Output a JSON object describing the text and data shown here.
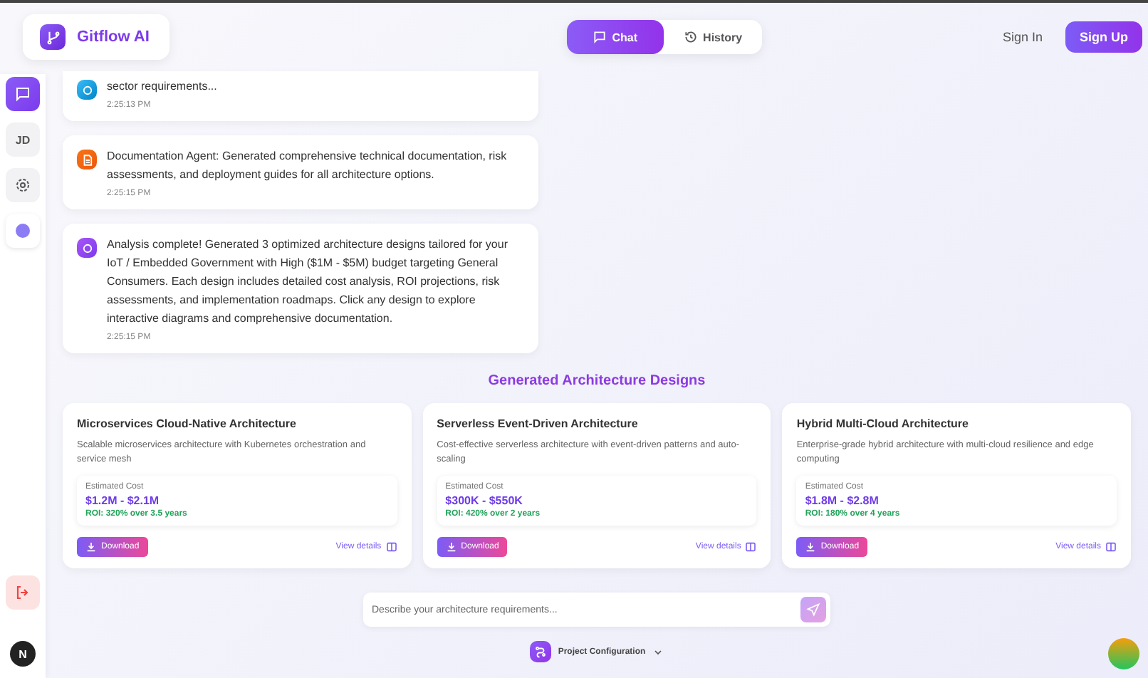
{
  "brand": {
    "name": "Gitflow AI"
  },
  "tabs": [
    {
      "label": "Chat",
      "selected": true,
      "kind": "chat"
    },
    {
      "label": "History",
      "selected": false,
      "kind": "history"
    }
  ],
  "auth": {
    "sign_in": "Sign In",
    "sign_up": "Sign Up"
  },
  "sidebar": {
    "items": [
      {
        "kind": "chat",
        "selected": true
      },
      {
        "kind": "avatar",
        "label": "JD",
        "selected": false
      },
      {
        "kind": "settings",
        "selected": false
      },
      {
        "kind": "dot",
        "selected": false
      }
    ],
    "user_initial": "N"
  },
  "messages": [
    {
      "kind": "info",
      "text": "sector requirements...",
      "time": "2:25:13 PM"
    },
    {
      "kind": "document",
      "text": "Documentation Agent: Generated comprehensive technical documentation, risk assessments, and deployment guides for all architecture options.",
      "time": "2:25:15 PM"
    },
    {
      "kind": "analysis",
      "text": "Analysis complete! Generated 3 optimized architecture designs tailored for your IoT / Embedded Government with High ($1M - $5M) budget targeting General Consumers. Each design includes detailed cost analysis, ROI projections, risk assessments, and implementation roadmaps. Click any design to explore interactive diagrams and comprehensive documentation.",
      "time": "2:25:15 PM"
    }
  ],
  "designs_title": "Generated Architecture Designs",
  "designs": [
    {
      "title": "Microservices Cloud-Native Architecture",
      "description": "Scalable microservices architecture with Kubernetes orchestration and service mesh",
      "cost_label": "Estimated Cost",
      "cost": "$1.2M - $2.1M",
      "roi": "ROI: 320% over 3.5 years",
      "download": "Download",
      "details": "View details"
    },
    {
      "title": "Serverless Event-Driven Architecture",
      "description": "Cost-effective serverless architecture with event-driven patterns and auto-scaling",
      "cost_label": "Estimated Cost",
      "cost": "$300K - $550K",
      "roi": "ROI: 420% over 2 years",
      "download": "Download",
      "details": "View details"
    },
    {
      "title": "Hybrid Multi-Cloud Architecture",
      "description": "Enterprise-grade hybrid architecture with multi-cloud resilience and edge computing",
      "cost_label": "Estimated Cost",
      "cost": "$1.8M - $2.8M",
      "roi": "ROI: 180% over 4 years",
      "download": "Download",
      "details": "View details"
    }
  ],
  "composer": {
    "placeholder": "Describe your architecture requirements..."
  },
  "project_config": {
    "label": "Project Configuration"
  }
}
